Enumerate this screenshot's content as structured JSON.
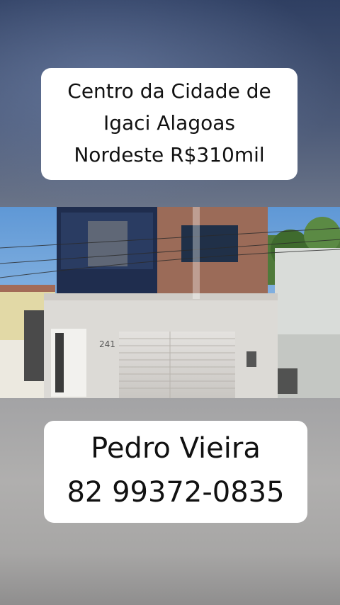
{
  "caption_top": {
    "line1": "Centro da Cidade de",
    "line2": "Igaci Alagoas",
    "line3": "Nordeste R$310mil"
  },
  "photo": {
    "house_number": "241"
  },
  "caption_bottom": {
    "name": "Pedro Vieira",
    "phone": "82 99372-0835"
  }
}
